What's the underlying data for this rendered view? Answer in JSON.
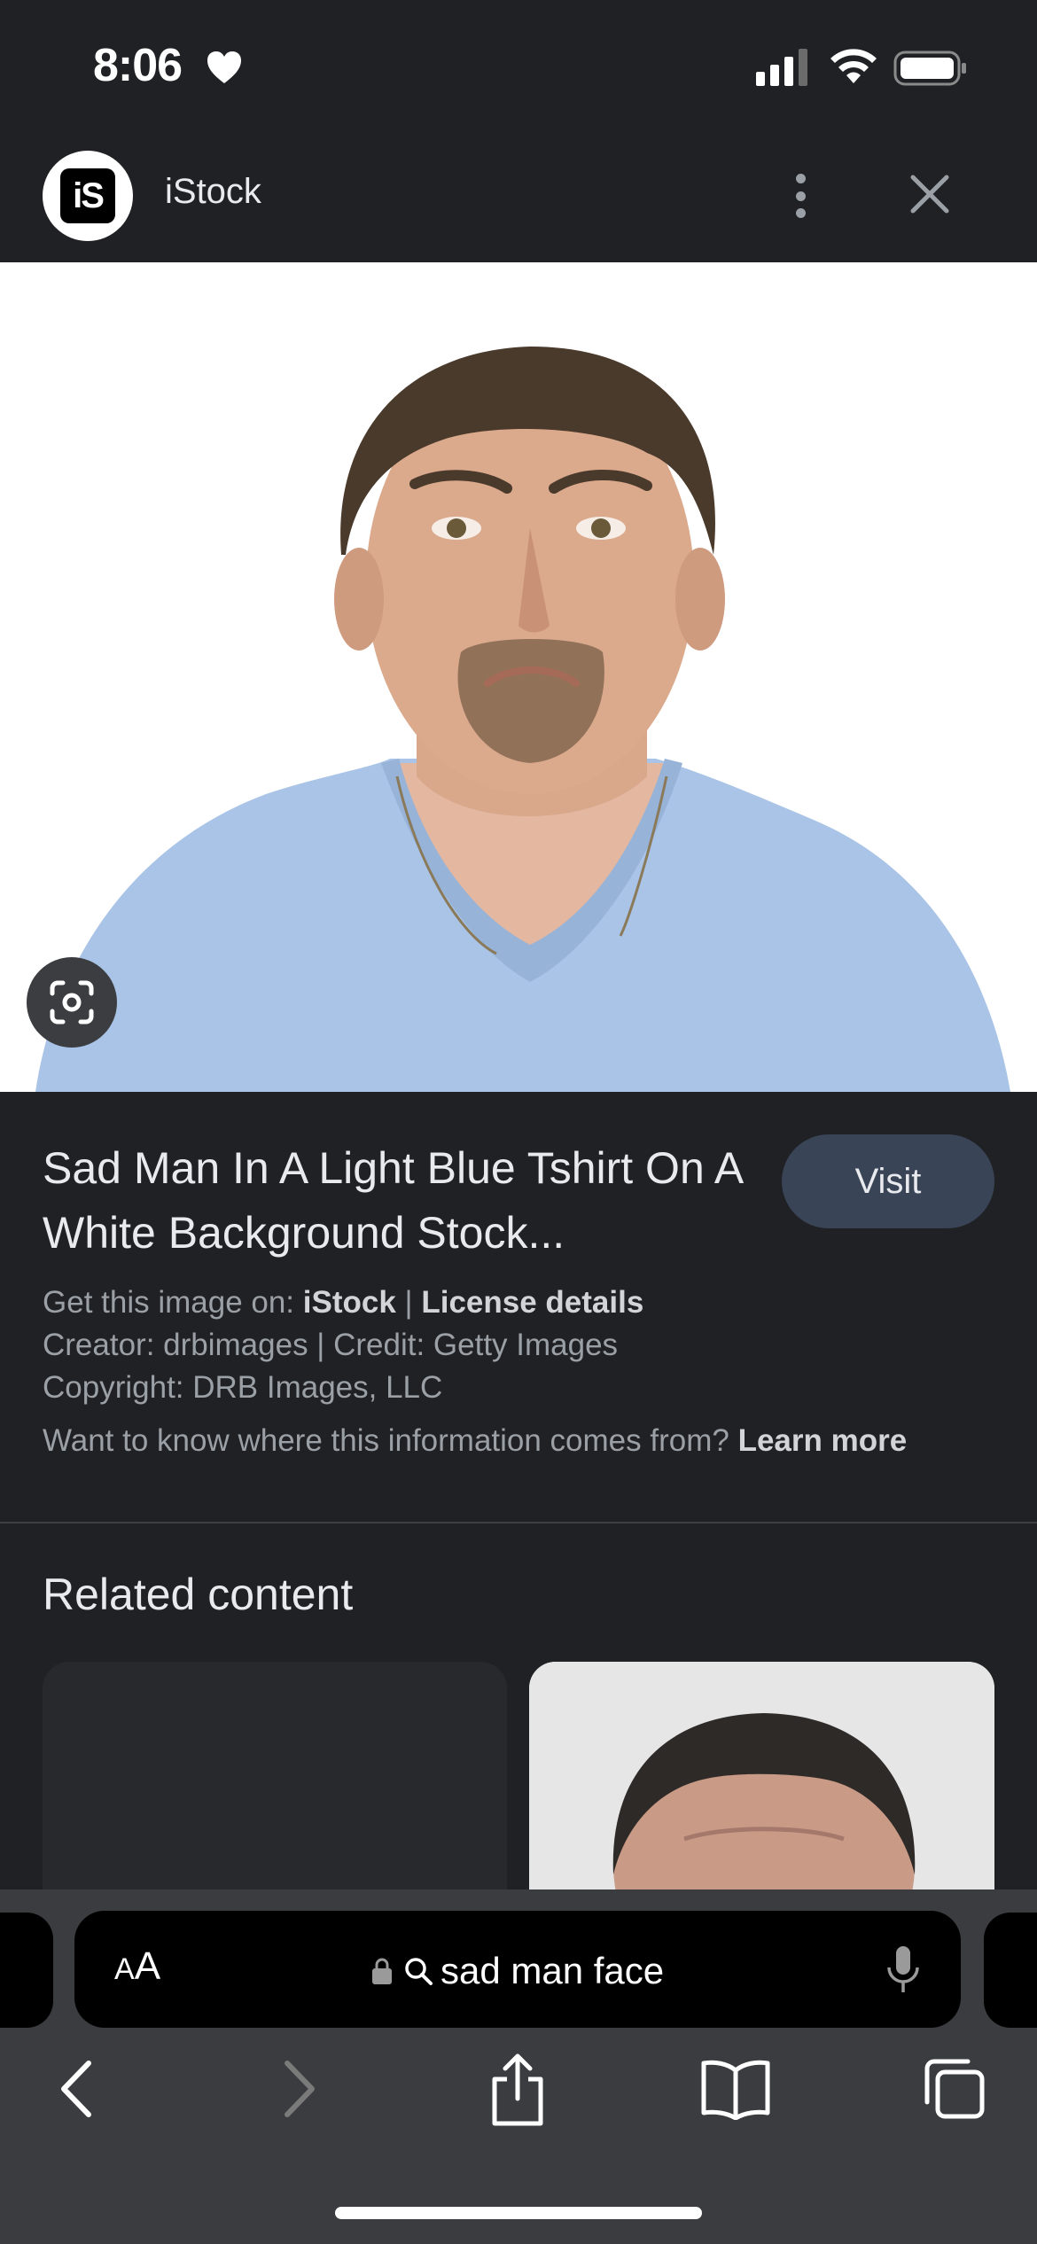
{
  "status_bar": {
    "time": "8:06"
  },
  "header": {
    "site_name": "iStock",
    "logo_text": "iS"
  },
  "image": {
    "title": "Sad Man In A Light Blue Tshirt On A White Background Stock...",
    "visit_label": "Visit"
  },
  "meta": {
    "get_prefix": "Get this image on: ",
    "source": "iStock",
    "separator": " | ",
    "license_link": "License details",
    "creator_line": "Creator: drbimages | Credit: Getty Images",
    "copyright_line": "Copyright: DRB Images, LLC",
    "info_question": "Want to know where this information comes from? ",
    "learn_more": "Learn more"
  },
  "related": {
    "title": "Related content"
  },
  "browser": {
    "aa_label_small": "A",
    "aa_label_large": "A",
    "address_text": "sad man face"
  },
  "colors": {
    "background": "#202124",
    "visit_button": "#394457",
    "toolbar": "#3b3c3f",
    "shirt": "#a9c4e6"
  },
  "icons": {
    "status": [
      "heart-icon",
      "signal-icon",
      "wifi-icon",
      "battery-icon"
    ],
    "header": [
      "more-vert-icon",
      "close-icon"
    ],
    "toolbar": [
      "back-icon",
      "forward-icon",
      "share-icon",
      "bookmarks-icon",
      "tabs-icon"
    ],
    "address": [
      "lock-icon",
      "search-icon",
      "mic-icon"
    ],
    "image": [
      "lens-icon"
    ]
  }
}
